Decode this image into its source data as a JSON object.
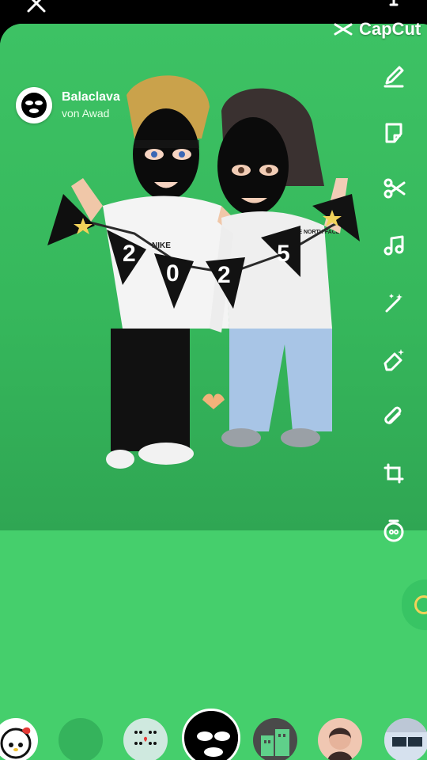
{
  "app": {
    "brand": "CapCut"
  },
  "lens": {
    "title": "Balaclava",
    "creator": "von Awad"
  },
  "scene": {
    "banner_digits": [
      "2",
      "0",
      "2",
      "5"
    ],
    "shirt_logo": "NIKE",
    "jacket_logo": "THE NORTH FACE"
  },
  "tools": [
    {
      "name": "pencil-icon"
    },
    {
      "name": "sticker-icon"
    },
    {
      "name": "scissors-icon"
    },
    {
      "name": "music-icon"
    },
    {
      "name": "magic-wand-icon"
    },
    {
      "name": "eraser-icon"
    },
    {
      "name": "paperclip-icon"
    },
    {
      "name": "crop-icon"
    },
    {
      "name": "timer-icon"
    }
  ],
  "carousel": [
    {
      "name": "hello-kitty-lens"
    },
    {
      "name": "blank-lens"
    },
    {
      "name": "faces-pattern-lens"
    },
    {
      "name": "balaclava-lens",
      "selected": true
    },
    {
      "name": "buildings-lens"
    },
    {
      "name": "portrait-lens"
    },
    {
      "name": "photo-lens"
    }
  ],
  "colors": {
    "background_green": "#45cf6c",
    "video_green": "#36b85c",
    "text_white": "#ffffff"
  }
}
